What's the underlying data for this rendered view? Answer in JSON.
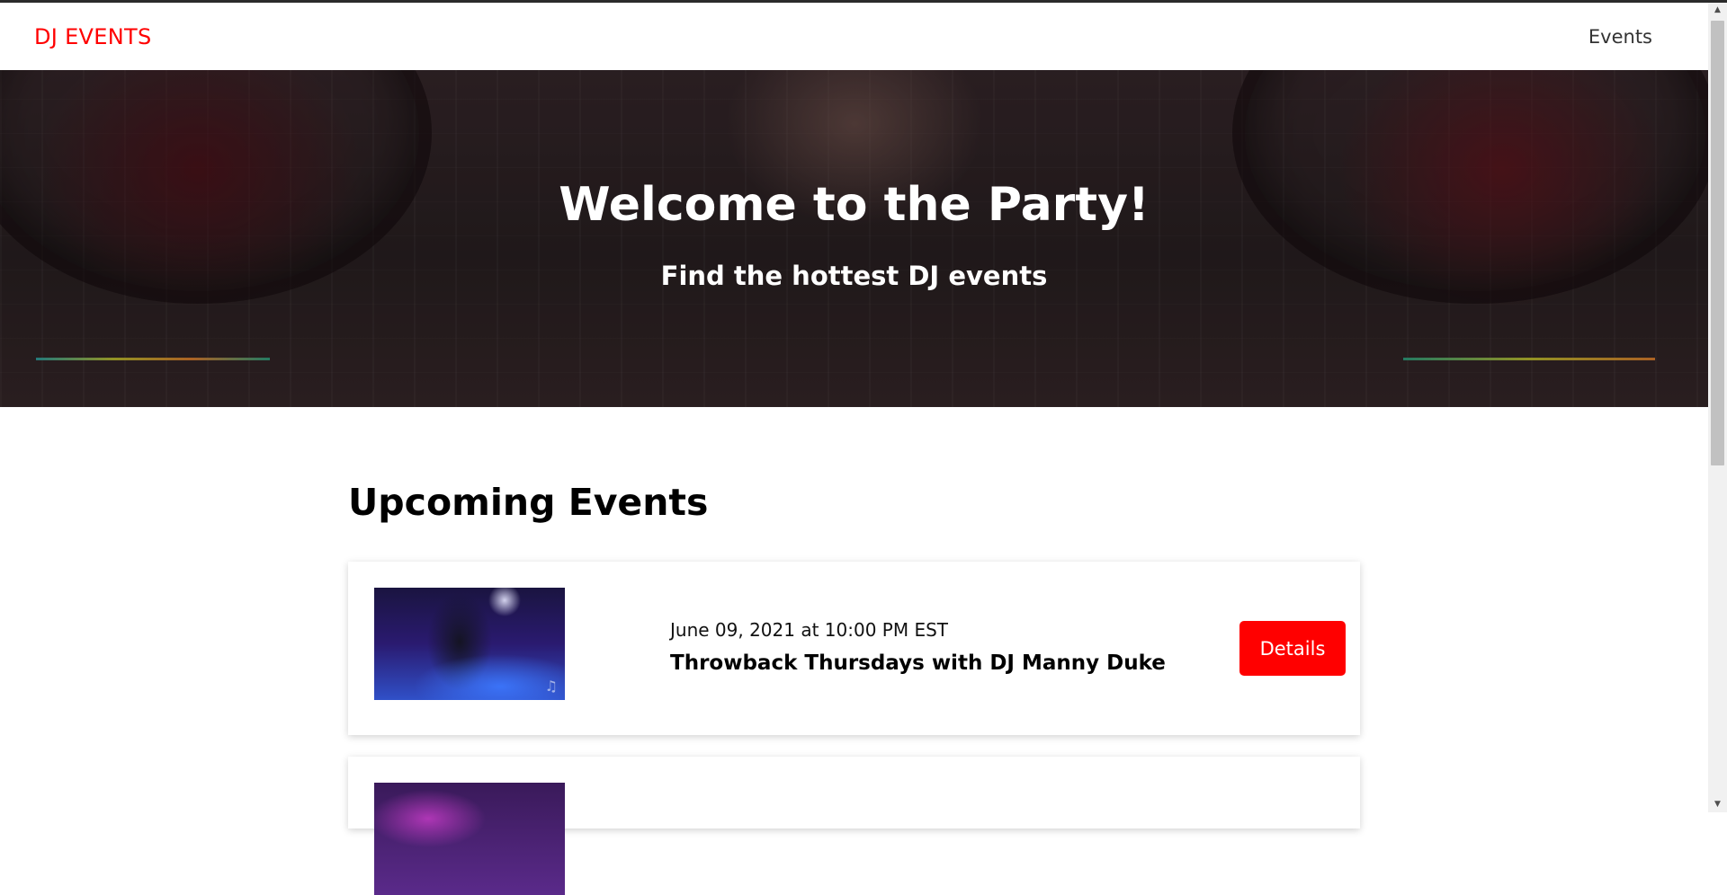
{
  "header": {
    "logo": "DJ EVENTS",
    "nav": [
      {
        "label": "Events"
      }
    ]
  },
  "hero": {
    "title": "Welcome to the Party!",
    "subtitle": "Find the hottest DJ events"
  },
  "main": {
    "section_title": "Upcoming Events",
    "events": [
      {
        "date": "June 09, 2021 at 10:00 PM EST",
        "name": "Throwback Thursdays with DJ Manny Duke",
        "button_label": "Details"
      },
      {
        "date": "",
        "name": "",
        "button_label": ""
      }
    ]
  },
  "colors": {
    "brand": "#ff0000",
    "button_text": "#ffffff"
  },
  "icons": {
    "scroll_up": "triangle-up-icon",
    "scroll_down": "triangle-down-icon"
  }
}
